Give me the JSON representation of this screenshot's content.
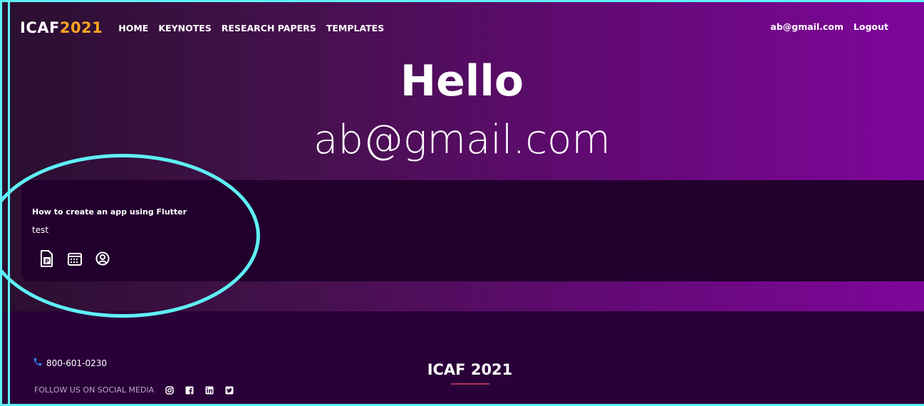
{
  "nav": {
    "brand_prefix": "ICAF",
    "brand_year": "2021",
    "links": [
      "HOME",
      "KEYNOTES",
      "RESEARCH PAPERS",
      "TEMPLATES"
    ],
    "user_email": "ab@gmail.com",
    "logout_label": "Logout"
  },
  "hero": {
    "greeting": "Hello",
    "email": "ab@gmail.com"
  },
  "card": {
    "title": "How to create an app using Flutter",
    "description": "test",
    "icons": [
      "document-p-icon",
      "calendar-icon",
      "user-circle-icon"
    ]
  },
  "footer": {
    "phone": "800-601-0230",
    "follow_label": "FOLLOW US ON SOCIAL MEDIA",
    "social_icons": [
      "instagram-icon",
      "facebook-icon",
      "linkedin-icon",
      "twitter-icon"
    ],
    "title": "ICAF 2021"
  },
  "colors": {
    "accent_brand_year": "#ffa51f",
    "highlight": "#5ef0f5",
    "card_bg": "#22002d",
    "footer_bg": "#2a0038"
  }
}
